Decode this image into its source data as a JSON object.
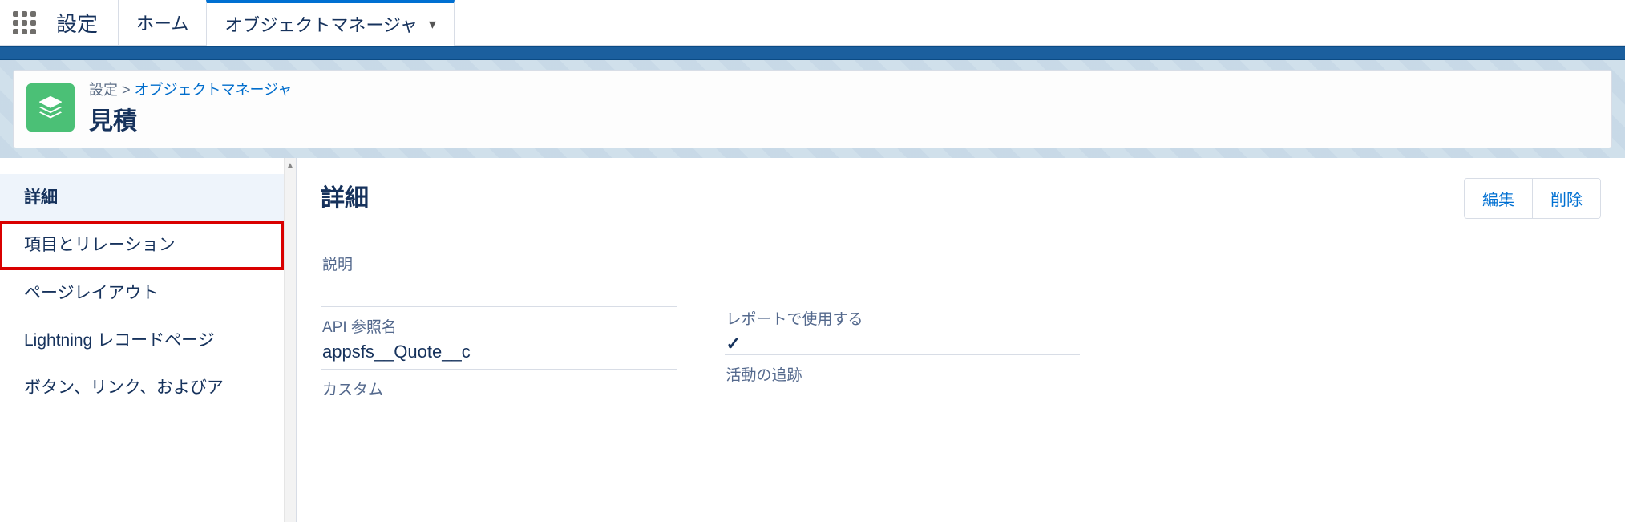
{
  "header": {
    "title": "設定",
    "tabs": [
      {
        "label": "ホーム",
        "active": false,
        "has_dropdown": false
      },
      {
        "label": "オブジェクトマネージャ",
        "active": true,
        "has_dropdown": true
      }
    ]
  },
  "breadcrumb": {
    "text": "設定",
    "link_text": "オブジェクトマネージャ",
    "separator": ">",
    "object_title": "見積",
    "icon": "layers-icon"
  },
  "sidebar": {
    "items": [
      {
        "label": "詳細",
        "active": true,
        "highlight": false
      },
      {
        "label": "項目とリレーション",
        "active": false,
        "highlight": true
      },
      {
        "label": "ページレイアウト",
        "active": false,
        "highlight": false
      },
      {
        "label": "Lightning レコードページ",
        "active": false,
        "highlight": false
      },
      {
        "label": "ボタン、リンク、およびア",
        "active": false,
        "highlight": false
      }
    ]
  },
  "detail": {
    "heading": "詳細",
    "buttons": {
      "edit": "編集",
      "delete": "削除"
    },
    "fields": {
      "description_label": "説明",
      "description_value": "",
      "api_name_label": "API 参照名",
      "api_name_value": "appsfs__Quote__c",
      "custom_label": "カスタム",
      "report_label": "レポートで使用する",
      "report_value": "✓",
      "activity_label": "活動の追跡"
    }
  }
}
